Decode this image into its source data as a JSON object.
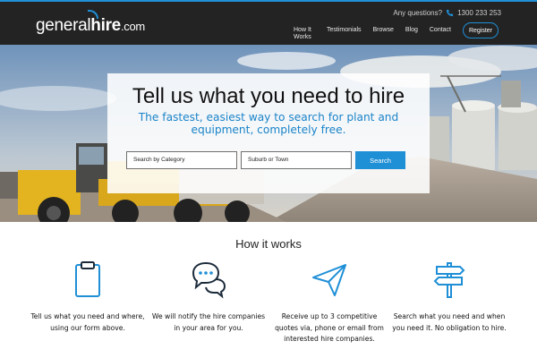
{
  "header": {
    "logo": {
      "part1": "general",
      "part2": "hire",
      "part3": ".com"
    },
    "contact_text": "Any questions?",
    "phone": "1300 233 253",
    "nav": [
      "How It Works",
      "Testimonials",
      "Browse",
      "Blog",
      "Contact"
    ],
    "register_label": "Register"
  },
  "hero": {
    "title": "Tell us what you need to hire",
    "subtitle": "The fastest, easiest way to search for plant and equipment, completely free.",
    "category_placeholder": "Search by Category",
    "suburb_placeholder": "Suburb or Town",
    "search_label": "Search"
  },
  "how": {
    "title": "How it works",
    "steps": [
      {
        "icon": "clipboard-icon",
        "text": "Tell us what you need and where, using our form above."
      },
      {
        "icon": "chat-icon",
        "text": "We will notify the hire companies in your area for you."
      },
      {
        "icon": "paper-plane-icon",
        "text": "Receive up to 3 competitive quotes via, phone or email from interested hire companies."
      },
      {
        "icon": "signpost-icon",
        "text": "Search what you need and when you need it. No obligation to hire."
      }
    ]
  },
  "colors": {
    "accent": "#1f8fd6",
    "header_bg": "#232323"
  }
}
